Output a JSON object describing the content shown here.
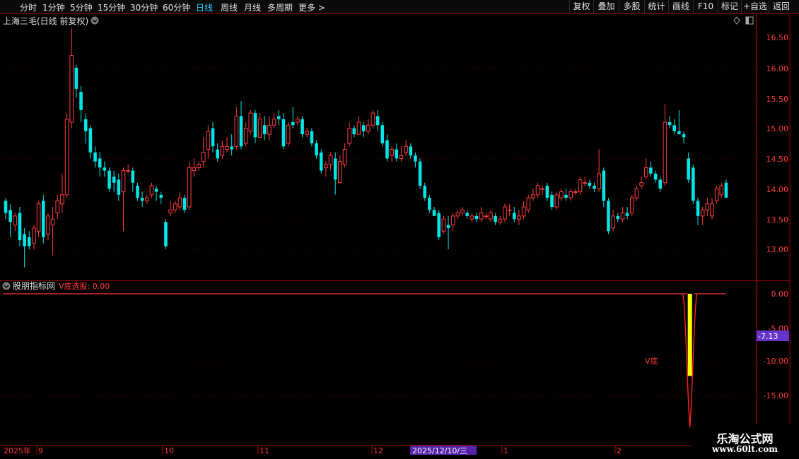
{
  "toolbar": {
    "periods": [
      "分时",
      "1分钟",
      "5分钟",
      "15分钟",
      "30分钟",
      "60分钟",
      "日线",
      "周线",
      "月线",
      "多周期",
      "更多 >"
    ],
    "active_period": "日线",
    "actions": [
      "复权",
      "叠加",
      "多股",
      "统计",
      "画线",
      "F10",
      "标记",
      "+自选",
      "返回"
    ]
  },
  "main_chart": {
    "title": "上海三毛(日线 前复权)",
    "price_ticks": [
      "16.50",
      "16.00",
      "15.50",
      "15.00",
      "14.50",
      "14.00",
      "13.50",
      "13.00"
    ],
    "colors": {
      "up": "#ff3b3b",
      "down": "#00e5e5",
      "grid": "#4a0000",
      "axis": "#b00000"
    }
  },
  "indicator": {
    "name": "股朋指标网",
    "value_label": "V底选股: 0.00",
    "ticks": [
      "0.00",
      "-5.00",
      "-10.00",
      "-15.00"
    ],
    "current_value": "-7.13",
    "signal_label": "V底"
  },
  "date_axis": {
    "labels": [
      "2025年",
      "9",
      "10",
      "11",
      "12",
      "1",
      "2"
    ],
    "cursor_date": "2025/12/10/三"
  },
  "watermark": {
    "line1": "乐淘公式网",
    "line2": "www.60lt.com"
  },
  "chart_data": {
    "type": "candlestick",
    "ylim": [
      12.6,
      16.8
    ],
    "candles": [
      [
        13.8,
        13.6,
        13.85,
        13.5
      ],
      [
        13.65,
        13.45,
        13.75,
        13.2
      ],
      [
        13.4,
        13.55,
        13.6,
        13.3
      ],
      [
        13.6,
        13.15,
        13.7,
        13.05
      ],
      [
        13.25,
        13.05,
        13.35,
        12.7
      ],
      [
        13.2,
        13.05,
        13.3,
        13.0
      ],
      [
        13.1,
        13.35,
        13.4,
        13.0
      ],
      [
        13.3,
        13.75,
        13.8,
        13.2
      ],
      [
        13.8,
        13.2,
        13.9,
        13.1
      ],
      [
        13.25,
        13.55,
        13.6,
        13.15
      ],
      [
        13.4,
        13.5,
        13.7,
        12.9
      ],
      [
        13.6,
        13.8,
        13.9,
        13.5
      ],
      [
        13.75,
        13.9,
        14.25,
        13.6
      ],
      [
        13.9,
        15.15,
        15.25,
        13.85
      ],
      [
        15.1,
        16.2,
        16.65,
        15.0
      ],
      [
        16.0,
        15.65,
        16.05,
        15.5
      ],
      [
        15.6,
        15.3,
        15.7,
        15.1
      ],
      [
        15.15,
        14.95,
        15.25,
        14.75
      ],
      [
        15.0,
        14.6,
        15.05,
        14.5
      ],
      [
        14.6,
        14.45,
        14.7,
        14.35
      ],
      [
        14.5,
        14.35,
        14.6,
        14.2
      ],
      [
        14.35,
        14.3,
        14.45,
        14.2
      ],
      [
        14.3,
        14.0,
        14.35,
        13.95
      ],
      [
        14.2,
        14.1,
        14.3,
        13.95
      ],
      [
        14.15,
        13.9,
        14.25,
        13.8
      ],
      [
        13.95,
        14.3,
        14.35,
        13.3
      ],
      [
        14.3,
        14.3,
        14.4,
        14.25
      ],
      [
        14.3,
        14.1,
        14.35,
        13.95
      ],
      [
        14.05,
        13.85,
        14.1,
        13.8
      ],
      [
        13.85,
        13.8,
        13.95,
        13.7
      ],
      [
        13.8,
        13.85,
        13.9,
        13.75
      ],
      [
        13.9,
        14.05,
        14.1,
        13.85
      ],
      [
        14.0,
        13.95,
        14.05,
        13.8
      ],
      [
        13.9,
        13.85,
        13.95,
        13.75
      ],
      [
        13.45,
        13.05,
        13.5,
        13.0
      ],
      [
        13.6,
        13.65,
        13.8,
        13.55
      ],
      [
        13.65,
        13.75,
        13.8,
        13.6
      ],
      [
        13.7,
        13.85,
        13.95,
        13.65
      ],
      [
        13.85,
        13.65,
        13.9,
        13.6
      ],
      [
        13.7,
        14.35,
        14.45,
        13.65
      ],
      [
        14.3,
        14.35,
        14.5,
        14.2
      ],
      [
        14.35,
        14.4,
        14.45,
        14.3
      ],
      [
        14.45,
        14.6,
        14.85,
        14.35
      ],
      [
        14.65,
        14.95,
        15.05,
        14.5
      ],
      [
        15.0,
        14.7,
        15.1,
        14.6
      ],
      [
        14.65,
        14.5,
        14.75,
        14.45
      ],
      [
        14.55,
        14.7,
        14.8,
        14.5
      ],
      [
        14.65,
        14.7,
        14.85,
        14.6
      ],
      [
        14.7,
        14.65,
        14.9,
        14.55
      ],
      [
        14.7,
        15.2,
        15.35,
        14.65
      ],
      [
        15.2,
        14.7,
        15.45,
        14.65
      ],
      [
        14.75,
        15.0,
        15.1,
        14.7
      ],
      [
        14.95,
        15.25,
        15.3,
        14.9
      ],
      [
        15.25,
        14.85,
        15.3,
        14.75
      ],
      [
        14.85,
        15.15,
        15.25,
        14.85
      ],
      [
        15.05,
        14.9,
        15.2,
        14.8
      ],
      [
        14.9,
        15.05,
        15.2,
        14.8
      ],
      [
        15.05,
        15.15,
        15.25,
        15.0
      ],
      [
        15.2,
        15.15,
        15.3,
        15.05
      ],
      [
        15.15,
        14.7,
        15.25,
        14.65
      ],
      [
        14.75,
        15.05,
        15.1,
        14.7
      ],
      [
        15.1,
        15.05,
        15.35,
        15.0
      ],
      [
        15.1,
        15.15,
        15.2,
        15.05
      ],
      [
        15.15,
        14.9,
        15.2,
        14.85
      ],
      [
        14.9,
        14.95,
        15.0,
        14.85
      ],
      [
        14.95,
        14.75,
        15.0,
        14.7
      ],
      [
        14.75,
        14.55,
        14.8,
        14.5
      ],
      [
        14.6,
        14.3,
        14.65,
        14.25
      ],
      [
        14.35,
        14.4,
        14.45,
        14.2
      ],
      [
        14.4,
        14.55,
        14.6,
        14.3
      ],
      [
        14.5,
        14.15,
        14.6,
        13.9
      ],
      [
        14.1,
        14.45,
        14.55,
        14.1
      ],
      [
        14.4,
        14.65,
        14.75,
        14.35
      ],
      [
        14.75,
        15.0,
        15.1,
        14.7
      ],
      [
        15.0,
        14.9,
        15.05,
        14.85
      ],
      [
        14.9,
        15.1,
        15.2,
        14.9
      ],
      [
        15.05,
        14.95,
        15.1,
        14.85
      ],
      [
        14.95,
        15.05,
        15.15,
        14.9
      ],
      [
        15.05,
        15.25,
        15.3,
        15.0
      ],
      [
        15.2,
        15.05,
        15.3,
        14.95
      ],
      [
        15.05,
        14.75,
        15.1,
        14.7
      ],
      [
        14.8,
        14.5,
        14.9,
        14.45
      ],
      [
        14.55,
        14.65,
        14.7,
        14.45
      ],
      [
        14.65,
        14.5,
        14.75,
        14.45
      ],
      [
        14.5,
        14.55,
        14.7,
        14.45
      ],
      [
        14.6,
        14.7,
        14.8,
        14.55
      ],
      [
        14.7,
        14.55,
        14.75,
        14.5
      ],
      [
        14.55,
        14.45,
        14.6,
        14.35
      ],
      [
        14.45,
        14.05,
        14.5,
        14.0
      ],
      [
        14.05,
        13.85,
        14.1,
        13.8
      ],
      [
        13.85,
        13.65,
        13.9,
        13.6
      ],
      [
        13.65,
        13.55,
        13.7,
        13.55
      ],
      [
        13.6,
        13.2,
        13.65,
        13.15
      ],
      [
        13.3,
        13.5,
        13.55,
        13.25
      ],
      [
        13.4,
        13.35,
        13.55,
        13.0
      ],
      [
        13.4,
        13.55,
        13.6,
        13.3
      ],
      [
        13.55,
        13.6,
        13.65,
        13.5
      ],
      [
        13.6,
        13.65,
        13.7,
        13.55
      ],
      [
        13.6,
        13.55,
        13.65,
        13.5
      ],
      [
        13.5,
        13.55,
        13.6,
        13.45
      ],
      [
        13.55,
        13.5,
        13.6,
        13.45
      ],
      [
        13.5,
        13.6,
        13.7,
        13.45
      ],
      [
        13.55,
        13.55,
        13.6,
        13.5
      ],
      [
        13.5,
        13.6,
        13.65,
        13.45
      ],
      [
        13.55,
        13.45,
        13.6,
        13.4
      ],
      [
        13.45,
        13.5,
        13.55,
        13.4
      ],
      [
        13.5,
        13.7,
        13.75,
        13.45
      ],
      [
        13.65,
        13.65,
        13.75,
        13.55
      ],
      [
        13.6,
        13.5,
        13.7,
        13.45
      ],
      [
        13.5,
        13.55,
        13.65,
        13.4
      ],
      [
        13.55,
        13.7,
        13.8,
        13.5
      ],
      [
        13.65,
        13.85,
        13.9,
        13.6
      ],
      [
        13.85,
        13.9,
        14.0,
        13.8
      ],
      [
        13.9,
        14.05,
        14.1,
        13.85
      ],
      [
        14.0,
        14.0,
        14.05,
        13.9
      ],
      [
        14.05,
        13.85,
        14.1,
        13.8
      ],
      [
        13.9,
        13.7,
        13.95,
        13.65
      ],
      [
        13.7,
        13.9,
        13.95,
        13.65
      ],
      [
        13.85,
        13.95,
        14.0,
        13.8
      ],
      [
        13.9,
        13.85,
        14.0,
        13.8
      ],
      [
        13.85,
        13.95,
        14.0,
        13.8
      ],
      [
        13.95,
        13.95,
        14.0,
        13.9
      ],
      [
        13.95,
        14.15,
        14.2,
        13.9
      ],
      [
        14.1,
        14.1,
        14.2,
        14.05
      ],
      [
        14.1,
        14.05,
        14.15,
        14.0
      ],
      [
        14.05,
        14.0,
        14.1,
        13.95
      ],
      [
        14.0,
        14.25,
        14.65,
        13.95
      ],
      [
        14.3,
        13.8,
        14.35,
        13.7
      ],
      [
        13.8,
        13.3,
        13.85,
        13.25
      ],
      [
        13.35,
        13.55,
        13.65,
        13.3
      ],
      [
        13.55,
        13.5,
        13.6,
        13.45
      ],
      [
        13.5,
        13.6,
        13.7,
        13.45
      ],
      [
        13.6,
        13.55,
        13.7,
        13.5
      ],
      [
        13.6,
        13.85,
        13.9,
        13.55
      ],
      [
        13.85,
        14.0,
        14.05,
        13.8
      ],
      [
        14.05,
        14.1,
        14.2,
        14.0
      ],
      [
        14.2,
        14.35,
        14.5,
        14.15
      ],
      [
        14.35,
        14.25,
        14.45,
        14.2
      ],
      [
        14.25,
        14.15,
        14.3,
        14.1
      ],
      [
        14.15,
        14.0,
        14.2,
        13.95
      ],
      [
        14.1,
        15.1,
        15.4,
        14.05
      ],
      [
        15.1,
        15.05,
        15.2,
        15.0
      ],
      [
        15.05,
        14.95,
        15.15,
        14.9
      ],
      [
        14.95,
        14.9,
        15.3,
        14.9
      ],
      [
        14.9,
        14.85,
        14.95,
        14.75
      ],
      [
        14.5,
        14.15,
        14.6,
        14.1
      ],
      [
        14.35,
        13.8,
        14.4,
        13.75
      ],
      [
        13.8,
        13.55,
        13.85,
        13.4
      ],
      [
        13.55,
        13.65,
        13.7,
        13.4
      ],
      [
        13.65,
        13.75,
        13.85,
        13.55
      ],
      [
        13.55,
        13.75,
        13.85,
        13.5
      ],
      [
        13.8,
        14.0,
        14.05,
        13.75
      ],
      [
        13.9,
        14.05,
        14.1,
        13.85
      ],
      [
        14.1,
        13.85,
        14.15,
        13.85
      ]
    ],
    "indicator_values": {
      "baseline": 0.0,
      "dip_start_index": 145,
      "dip_min": -19.5,
      "signal_level": -12.0
    }
  }
}
